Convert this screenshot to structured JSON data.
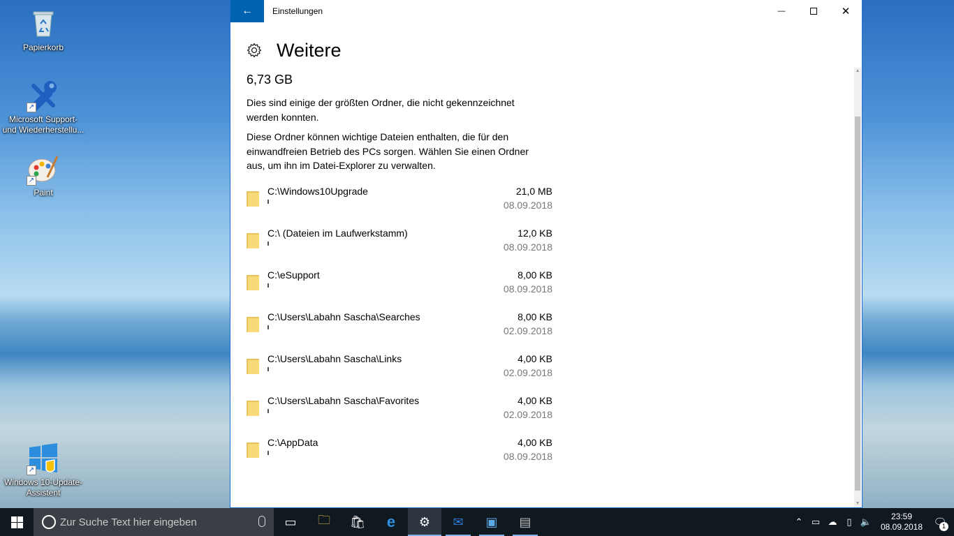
{
  "desktop": {
    "icons": [
      {
        "label": "Papierkorb",
        "icon": "recycle-bin-icon"
      },
      {
        "label": "Microsoft Support- und Wiederherstellu...",
        "icon": "tools-icon"
      },
      {
        "label": "Paint",
        "icon": "paint-palette-icon"
      },
      {
        "label": "Windows 10-Update-Assistent",
        "icon": "windows-update-icon"
      }
    ]
  },
  "window": {
    "title": "Einstellungen",
    "back_glyph": "←",
    "minimize_glyph": "—",
    "close_glyph": "✕"
  },
  "page": {
    "title": "Weitere",
    "total_size": "6,73 GB",
    "description_1": "Dies sind einige der größten Ordner, die nicht gekennzeichnet werden konnten.",
    "description_2": "Diese Ordner können wichtige Dateien enthalten, die für den einwandfreien Betrieb des PCs sorgen. Wählen Sie einen Ordner aus, um ihn im Datei-Explorer zu verwalten."
  },
  "folders": [
    {
      "path": "C:\\Windows10Upgrade",
      "size": "21,0 MB",
      "date": "08.09.2018"
    },
    {
      "path": "C:\\ (Dateien im Laufwerkstamm)",
      "size": "12,0 KB",
      "date": "08.09.2018"
    },
    {
      "path": "C:\\eSupport",
      "size": "8,00 KB",
      "date": "08.09.2018"
    },
    {
      "path": "C:\\Users\\Labahn Sascha\\Searches",
      "size": "8,00 KB",
      "date": "02.09.2018"
    },
    {
      "path": "C:\\Users\\Labahn Sascha\\Links",
      "size": "4,00 KB",
      "date": "02.09.2018"
    },
    {
      "path": "C:\\Users\\Labahn Sascha\\Favorites",
      "size": "4,00 KB",
      "date": "02.09.2018"
    },
    {
      "path": "C:\\AppData",
      "size": "4,00 KB",
      "date": "08.09.2018"
    }
  ],
  "taskbar": {
    "search_placeholder": "Zur Suche Text hier eingeben",
    "apps": [
      {
        "name": "task-view-icon",
        "glyph": "▭"
      },
      {
        "name": "file-explorer-icon",
        "glyph": "🗀"
      },
      {
        "name": "store-icon",
        "glyph": "🛍"
      },
      {
        "name": "edge-icon",
        "glyph": "e"
      },
      {
        "name": "settings-icon",
        "glyph": "⚙"
      },
      {
        "name": "outlook-icon",
        "glyph": "✉"
      },
      {
        "name": "control-panel-icon",
        "glyph": "▣"
      },
      {
        "name": "installer-icon",
        "glyph": "▤"
      }
    ],
    "time": "23:59",
    "date": "08.09.2018",
    "notification_count": "1"
  }
}
